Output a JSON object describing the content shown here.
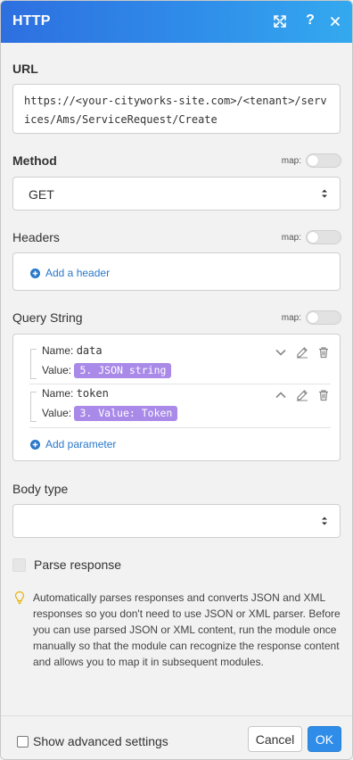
{
  "header": {
    "title": "HTTP",
    "icons": [
      "expand-icon",
      "help-icon",
      "close-icon"
    ],
    "help_glyph": "?"
  },
  "url": {
    "label": "URL",
    "value": "https://<your-cityworks-site.com>/<tenant>/services/Ams/ServiceRequest/Create"
  },
  "method": {
    "label": "Method",
    "map_label": "map:",
    "value": "GET"
  },
  "headers": {
    "label": "Headers",
    "map_label": "map:",
    "add_label": "Add a header"
  },
  "query": {
    "label": "Query String",
    "map_label": "map:",
    "items": [
      {
        "name_label": "Name:",
        "name": "data",
        "value_label": "Value:",
        "value": "5. JSON string",
        "expanded": false
      },
      {
        "name_label": "Name:",
        "name": "token",
        "value_label": "Value:",
        "value": "3. Value: Token",
        "expanded": true
      }
    ],
    "add_label": "Add parameter"
  },
  "body_type": {
    "label": "Body type",
    "value": ""
  },
  "parse_response": {
    "label": "Parse response",
    "checked": false
  },
  "info": {
    "text": "Automatically parses responses and converts JSON and XML responses so you don't need to use JSON or XML parser. Before you can use parsed JSON or XML content, run the module once manually so that the module can recognize the response content and allows you to map it in subsequent modules."
  },
  "footer": {
    "advanced_label": "Show advanced settings",
    "cancel_label": "Cancel",
    "ok_label": "OK"
  },
  "colors": {
    "header_start": "#2e6fe0",
    "header_end": "#34a9ef",
    "pill": "#a98ae8",
    "link": "#2a77c9",
    "ok": "#2f8de9"
  }
}
